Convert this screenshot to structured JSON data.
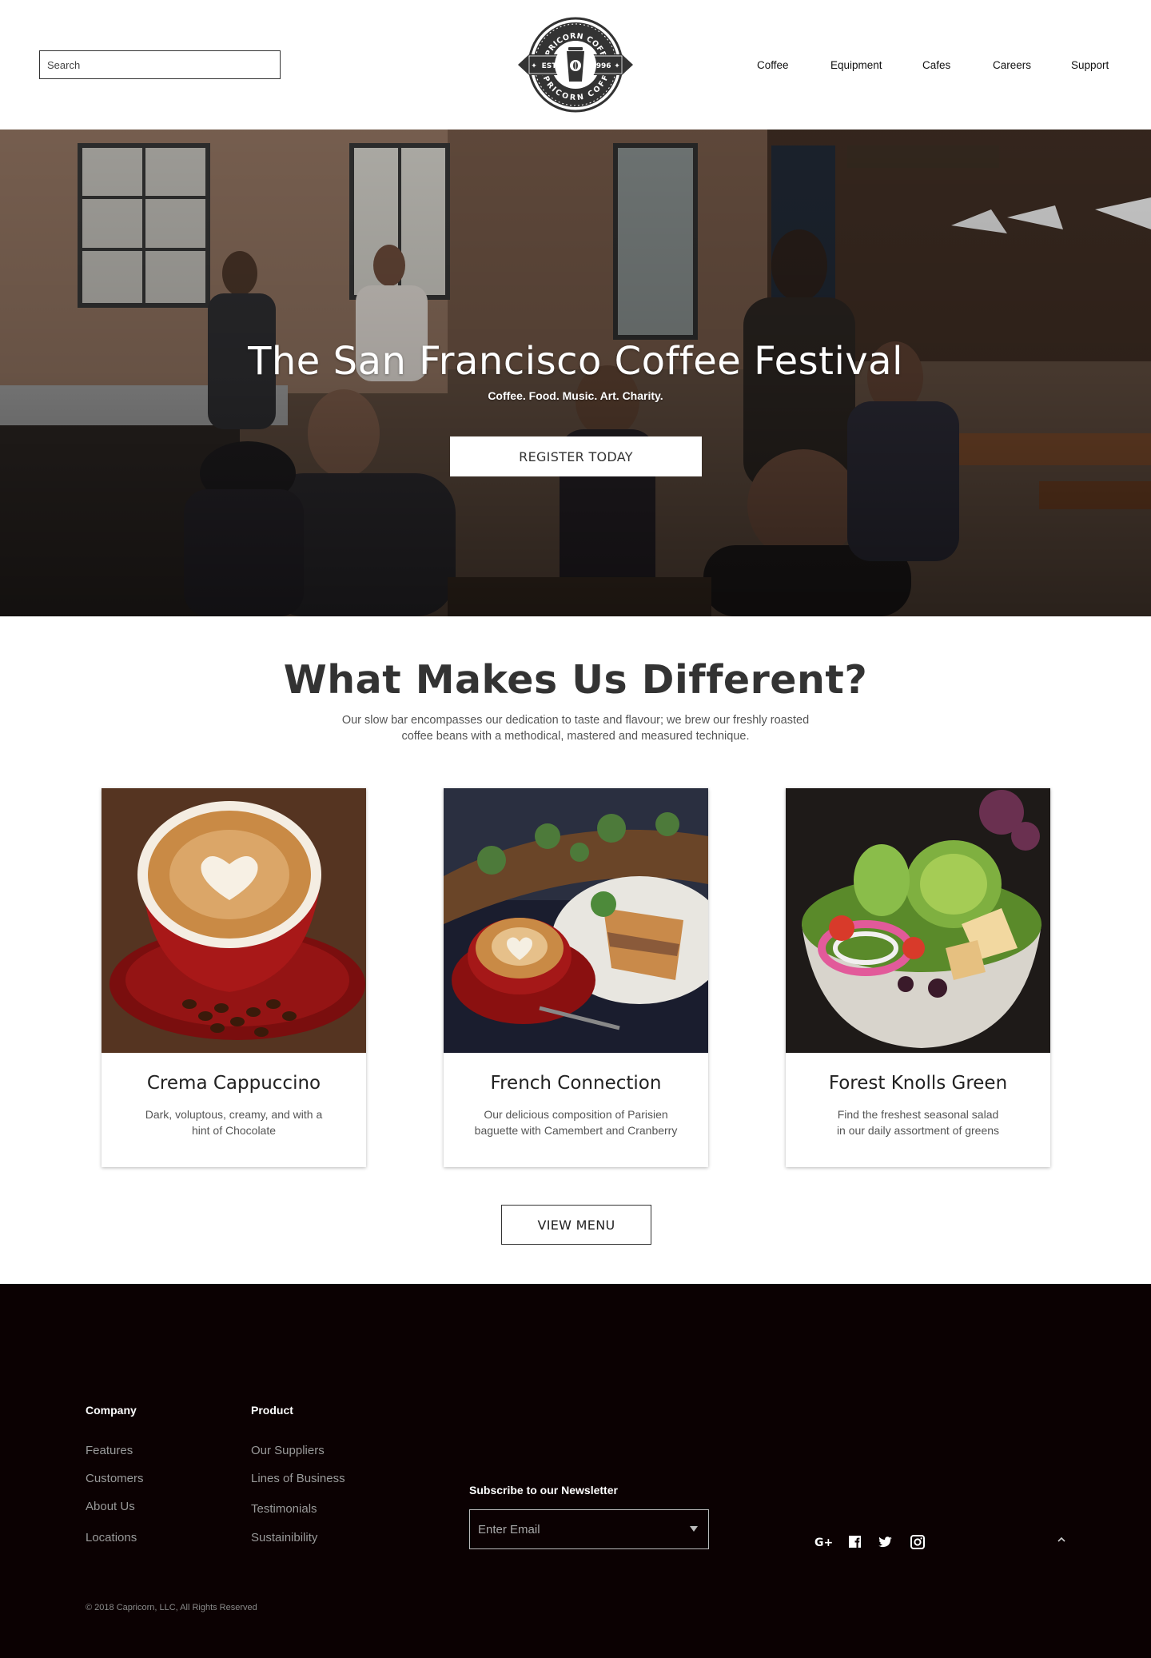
{
  "header": {
    "search_placeholder": "Search",
    "logo": {
      "top_text": "CAPRICORN COFFEE",
      "bottom_text": "CAPRICORN COFFEE",
      "left_badge": "EST.",
      "right_badge": "1996"
    },
    "nav": [
      "Coffee",
      "Equipment",
      "Cafes",
      "Careers",
      "Support"
    ]
  },
  "hero": {
    "title": "The San Francisco Coffee Festival",
    "subtitle": "Coffee. Food. Music. Art. Charity.",
    "button": "REGISTER TODAY"
  },
  "features": {
    "title": "What Makes Us Different?",
    "description_line1": "Our slow bar encompasses our dedication to taste and flavour; we brew our freshly roasted",
    "description_line2": "coffee beans with a methodical, mastered and measured technique.",
    "cards": [
      {
        "title": "Crema Cappuccino",
        "desc1": "Dark, voluptous, creamy, and with a",
        "desc2": "hint of Chocolate"
      },
      {
        "title": "French Connection",
        "desc1": "Our delicious composition of Parisien",
        "desc2": "baguette with Camembert and Cranberry"
      },
      {
        "title": "Forest Knolls Green",
        "desc1": "Find the freshest seasonal salad",
        "desc2": "in our daily assortment of greens"
      }
    ],
    "menu_button": "VIEW MENU"
  },
  "footer": {
    "company": {
      "heading": "Company",
      "links": [
        "Features",
        "Customers",
        "About Us",
        "Locations"
      ]
    },
    "product": {
      "heading": "Product",
      "links": [
        "Our Suppliers",
        "Lines of Business",
        "Testimonials",
        "Sustainibility"
      ]
    },
    "newsletter": {
      "label": "Subscribe to our Newsletter",
      "placeholder": "Enter Email"
    },
    "social_icons": [
      "google-plus-icon",
      "facebook-icon",
      "twitter-icon",
      "instagram-icon"
    ],
    "copyright": "© 2018  Capricorn, LLC, All Rights Reserved"
  },
  "colors": {
    "footer_bg": "#0b0102",
    "text_dark": "#333333",
    "text_muted": "#555555",
    "footer_link": "#9a9a9a"
  }
}
